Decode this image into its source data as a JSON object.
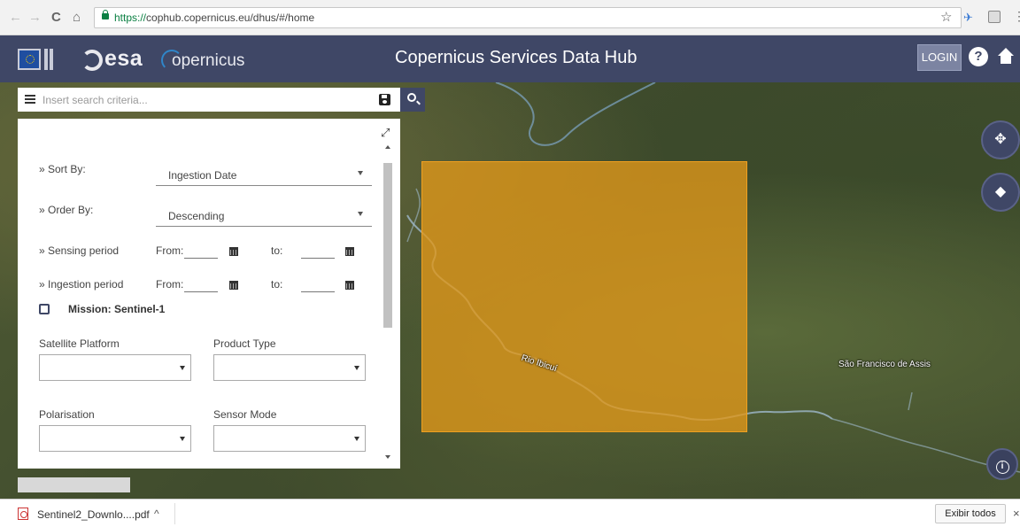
{
  "browser": {
    "back_icon": "←",
    "forward_icon": "→",
    "reload_icon": "C",
    "home_icon": "⌂",
    "url_protocol": "https://",
    "url_rest": "cophub.copernicus.eu/dhus/#/home",
    "star_icon": "☆",
    "extension_icon": "✈",
    "menu_icon": "⋮"
  },
  "header": {
    "esa_logo_text": "esa",
    "copernicus_logo_text": "opernicus",
    "title": "Copernicus Services Data Hub",
    "login_label": "LOGIN",
    "help_icon": "?",
    "bg_color": "#3f4766"
  },
  "search": {
    "placeholder": "Insert search criteria..."
  },
  "filters": {
    "sort_by_label": "» Sort By:",
    "sort_by_value": "Ingestion Date",
    "order_by_label": "» Order By:",
    "order_by_value": "Descending",
    "sensing_label": "» Sensing period",
    "ingestion_label": "» Ingestion period",
    "from_label": "From:",
    "to_label": "to:",
    "mission_label": "Mission: Sentinel-1",
    "platform_label": "Satellite Platform",
    "product_type_label": "Product Type",
    "polarisation_label": "Polarisation",
    "sensor_mode_label": "Sensor Mode",
    "expand_icon": "⤢"
  },
  "map": {
    "label_river": "Rio Ibicuí",
    "label_city": "São Francisco de Assis",
    "footprint_color": "#e2981a",
    "move_icon": "✥",
    "layers_icon": "◆",
    "info_icon": "i"
  },
  "downloads": {
    "file_name": "Sentinel2_Downlo....pdf",
    "caret": "^",
    "show_all_label": "Exibir todos",
    "close_icon": "×"
  }
}
